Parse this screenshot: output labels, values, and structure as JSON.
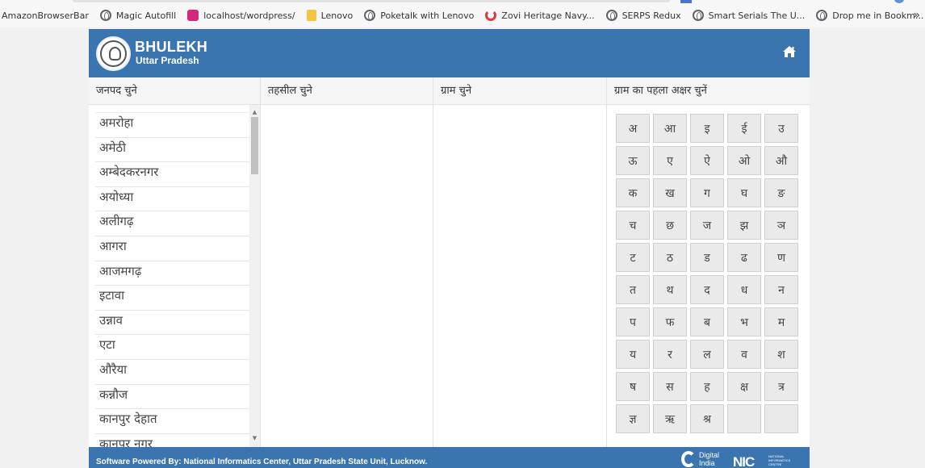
{
  "bookmarks": [
    {
      "label": "AmazonBrowserBar",
      "icon": "none"
    },
    {
      "label": "Magic Autofill",
      "icon": "globe-icon"
    },
    {
      "label": "localhost/wordpress/",
      "icon": "wordpress-icon"
    },
    {
      "label": "Lenovo",
      "icon": "folder-icon"
    },
    {
      "label": "Poketalk with Lenovo",
      "icon": "globe-icon"
    },
    {
      "label": "Zovi Heritage Navy...",
      "icon": "poketalk-icon"
    },
    {
      "label": "SERPS Redux",
      "icon": "zovi-icon"
    },
    {
      "label": "Smart Serials The U...",
      "icon": "globe-icon"
    },
    {
      "label": "Drop me in Bookm...",
      "icon": "smart-icon"
    }
  ],
  "bookmarks_more": "»",
  "header": {
    "title": "BHULEKH",
    "subtitle": "Uttar Pradesh",
    "home_icon": "home-icon"
  },
  "columns": {
    "janpad": "जनपद चुने",
    "tehsil": "तहसील चुने",
    "gram": "ग्राम चुने",
    "first_letter": "ग्राम का पहला अक्षर चुनें"
  },
  "districts": [
    "अमरोहा",
    "अमेठी",
    "अम्बेदकरनगर",
    "अयोध्या",
    "अलीगढ़",
    "आगरा",
    "आजमगढ़",
    "इटावा",
    "उन्नाव",
    "एटा",
    "औरैया",
    "कन्नौज",
    "कानपुर देहात",
    "कानपुर नगर"
  ],
  "letters": [
    "अ",
    "आ",
    "इ",
    "ई",
    "उ",
    "ऊ",
    "ए",
    "ऐ",
    "ओ",
    "औ",
    "क",
    "ख",
    "ग",
    "घ",
    "ङ",
    "च",
    "छ",
    "ज",
    "झ",
    "ञ",
    "ट",
    "ठ",
    "ड",
    "ढ",
    "ण",
    "त",
    "थ",
    "द",
    "ध",
    "न",
    "प",
    "फ",
    "ब",
    "भ",
    "म",
    "य",
    "र",
    "ल",
    "व",
    "श",
    "ष",
    "स",
    "ह",
    "क्ष",
    "त्र",
    "ज्ञ",
    "ऋ",
    "श्र",
    "",
    ""
  ],
  "footer": {
    "text": "Software Powered By: National Informatics Center, Uttar Pradesh State Unit, Lucknow.",
    "digital_india_line1": "Digital",
    "digital_india_line2": "India",
    "nic_logo": "NIC",
    "nic_line1": "NATIONAL",
    "nic_line2": "INFORMATICS",
    "nic_line3": "CENTRE"
  },
  "colors": {
    "brand_blue": "#3a75b0",
    "letter_bg": "#eaeaea"
  }
}
